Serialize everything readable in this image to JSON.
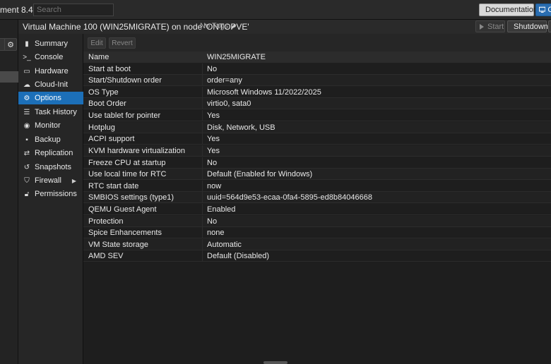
{
  "topbar": {
    "app_title": "ment 8.4.1",
    "search_placeholder": "Search",
    "documentation_label": "Documentation",
    "create_vm_label": "Cr"
  },
  "vm_header": {
    "title": "Virtual Machine 100 (WIN25MIGRATE) on node 'ONTOPVE'",
    "tags_label": "No Tags",
    "start_label": "Start",
    "shutdown_label": "Shutdown"
  },
  "nav": {
    "items": [
      {
        "label": "Summary",
        "icon": "book-icon",
        "active": false
      },
      {
        "label": "Console",
        "icon": "terminal-icon",
        "active": false
      },
      {
        "label": "Hardware",
        "icon": "monitor-icon",
        "active": false
      },
      {
        "label": "Cloud-Init",
        "icon": "cloud-icon",
        "active": false
      },
      {
        "label": "Options",
        "icon": "gear-icon",
        "active": true
      },
      {
        "label": "Task History",
        "icon": "list-icon",
        "active": false
      },
      {
        "label": "Monitor",
        "icon": "eye-icon",
        "active": false
      },
      {
        "label": "Backup",
        "icon": "floppy-icon",
        "active": false
      },
      {
        "label": "Replication",
        "icon": "retweet-icon",
        "active": false
      },
      {
        "label": "Snapshots",
        "icon": "history-icon",
        "active": false
      },
      {
        "label": "Firewall",
        "icon": "shield-icon",
        "active": false
      },
      {
        "label": "Permissions",
        "icon": "unlock-icon",
        "active": false
      }
    ]
  },
  "toolbar": {
    "edit_label": "Edit",
    "revert_label": "Revert"
  },
  "options": {
    "rows": [
      {
        "key": "Name",
        "value": "WIN25MIGRATE"
      },
      {
        "key": "Start at boot",
        "value": "No"
      },
      {
        "key": "Start/Shutdown order",
        "value": "order=any"
      },
      {
        "key": "OS Type",
        "value": "Microsoft Windows 11/2022/2025"
      },
      {
        "key": "Boot Order",
        "value": "virtio0, sata0"
      },
      {
        "key": "Use tablet for pointer",
        "value": "Yes"
      },
      {
        "key": "Hotplug",
        "value": "Disk, Network, USB"
      },
      {
        "key": "ACPI support",
        "value": "Yes"
      },
      {
        "key": "KVM hardware virtualization",
        "value": "Yes"
      },
      {
        "key": "Freeze CPU at startup",
        "value": "No"
      },
      {
        "key": "Use local time for RTC",
        "value": "Default (Enabled for Windows)"
      },
      {
        "key": "RTC start date",
        "value": "now"
      },
      {
        "key": "SMBIOS settings (type1)",
        "value": "uuid=564d9e53-ecaa-0fa4-5895-ed8b84046668"
      },
      {
        "key": "QEMU Guest Agent",
        "value": "Enabled"
      },
      {
        "key": "Protection",
        "value": "No"
      },
      {
        "key": "Spice Enhancements",
        "value": "none"
      },
      {
        "key": "VM State storage",
        "value": "Automatic"
      },
      {
        "key": "AMD SEV",
        "value": "Default (Disabled)"
      }
    ]
  },
  "colors": {
    "accent": "#1c6fb8",
    "background": "#1e1e1e"
  }
}
